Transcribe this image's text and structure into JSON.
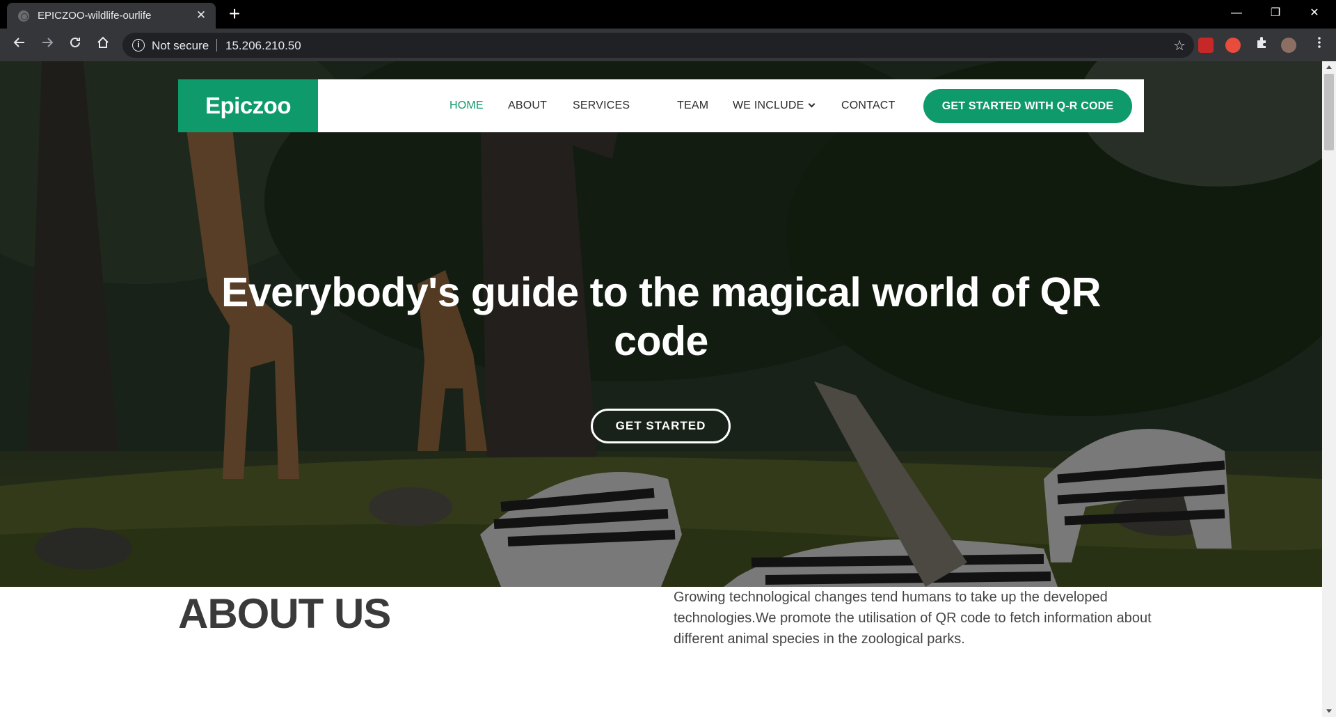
{
  "browser": {
    "tab_title": "EPICZOO-wildlife-ourlife",
    "tab_close": "✕",
    "new_tab": "+",
    "security_label": "Not secure",
    "url": "15.206.210.50",
    "window_controls": {
      "minimize": "—",
      "restore": "❐",
      "close": "✕"
    }
  },
  "nav": {
    "logo": "Epiczoo",
    "items": [
      "HOME",
      "ABOUT",
      "SERVICES",
      "TEAM",
      "WE INCLUDE",
      "CONTACT"
    ],
    "active": "HOME",
    "cta": "GET STARTED WITH Q-R CODE"
  },
  "hero": {
    "title": "Everybody's guide to the magical world of QR code",
    "button": "GET STARTED"
  },
  "about": {
    "title": "ABOUT US",
    "text": "Growing technological changes tend humans to take up the developed technologies.We promote the utilisation of QR code to fetch information about different animal species in the zoological parks."
  },
  "colors": {
    "brand_green": "#0e9a6b",
    "tabbar_bg": "#000000",
    "toolbar_bg": "#35363a"
  },
  "icons": [
    "back-arrow-icon",
    "forward-arrow-icon",
    "reload-icon",
    "home-icon",
    "info-icon",
    "star-icon",
    "extensions-icon",
    "menu-dots-icon"
  ]
}
